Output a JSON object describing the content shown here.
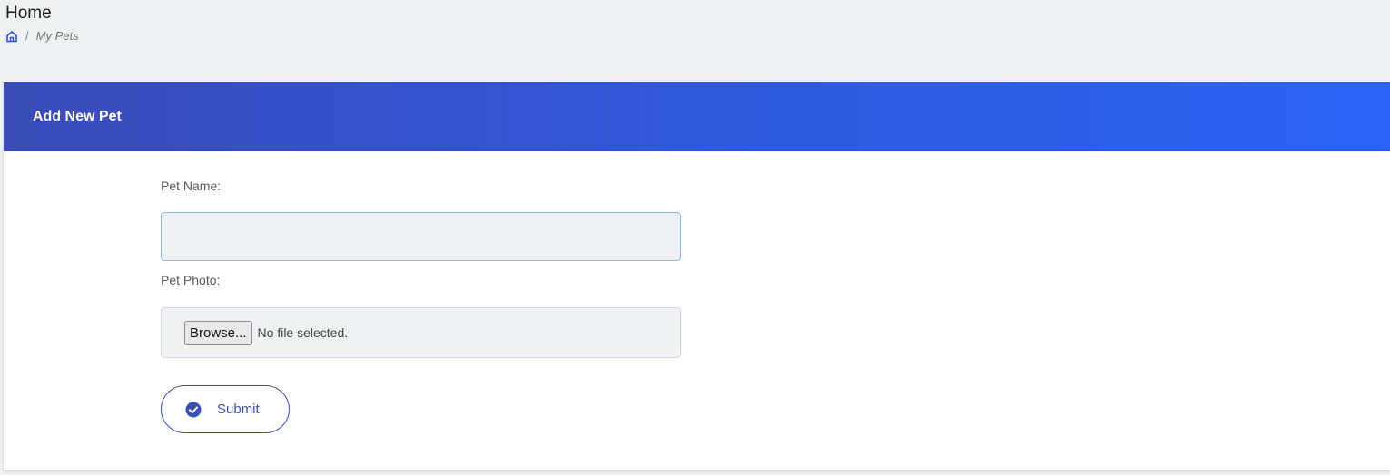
{
  "page": {
    "title": "Home",
    "breadcrumb": {
      "home_icon": "home-icon",
      "separator": "/",
      "current": "My Pets"
    }
  },
  "card": {
    "title": "Add New Pet",
    "header_gradient": [
      "#3a4bb9",
      "#2a63f5"
    ]
  },
  "form": {
    "pet_name_label": "Pet Name:",
    "pet_name_value": "",
    "pet_photo_label": "Pet Photo:",
    "browse_label": "Browse...",
    "file_status": "No file selected.",
    "submit_label": "Submit",
    "submit_icon": "check-circle-icon",
    "accent_color": "#3a4fb0"
  }
}
